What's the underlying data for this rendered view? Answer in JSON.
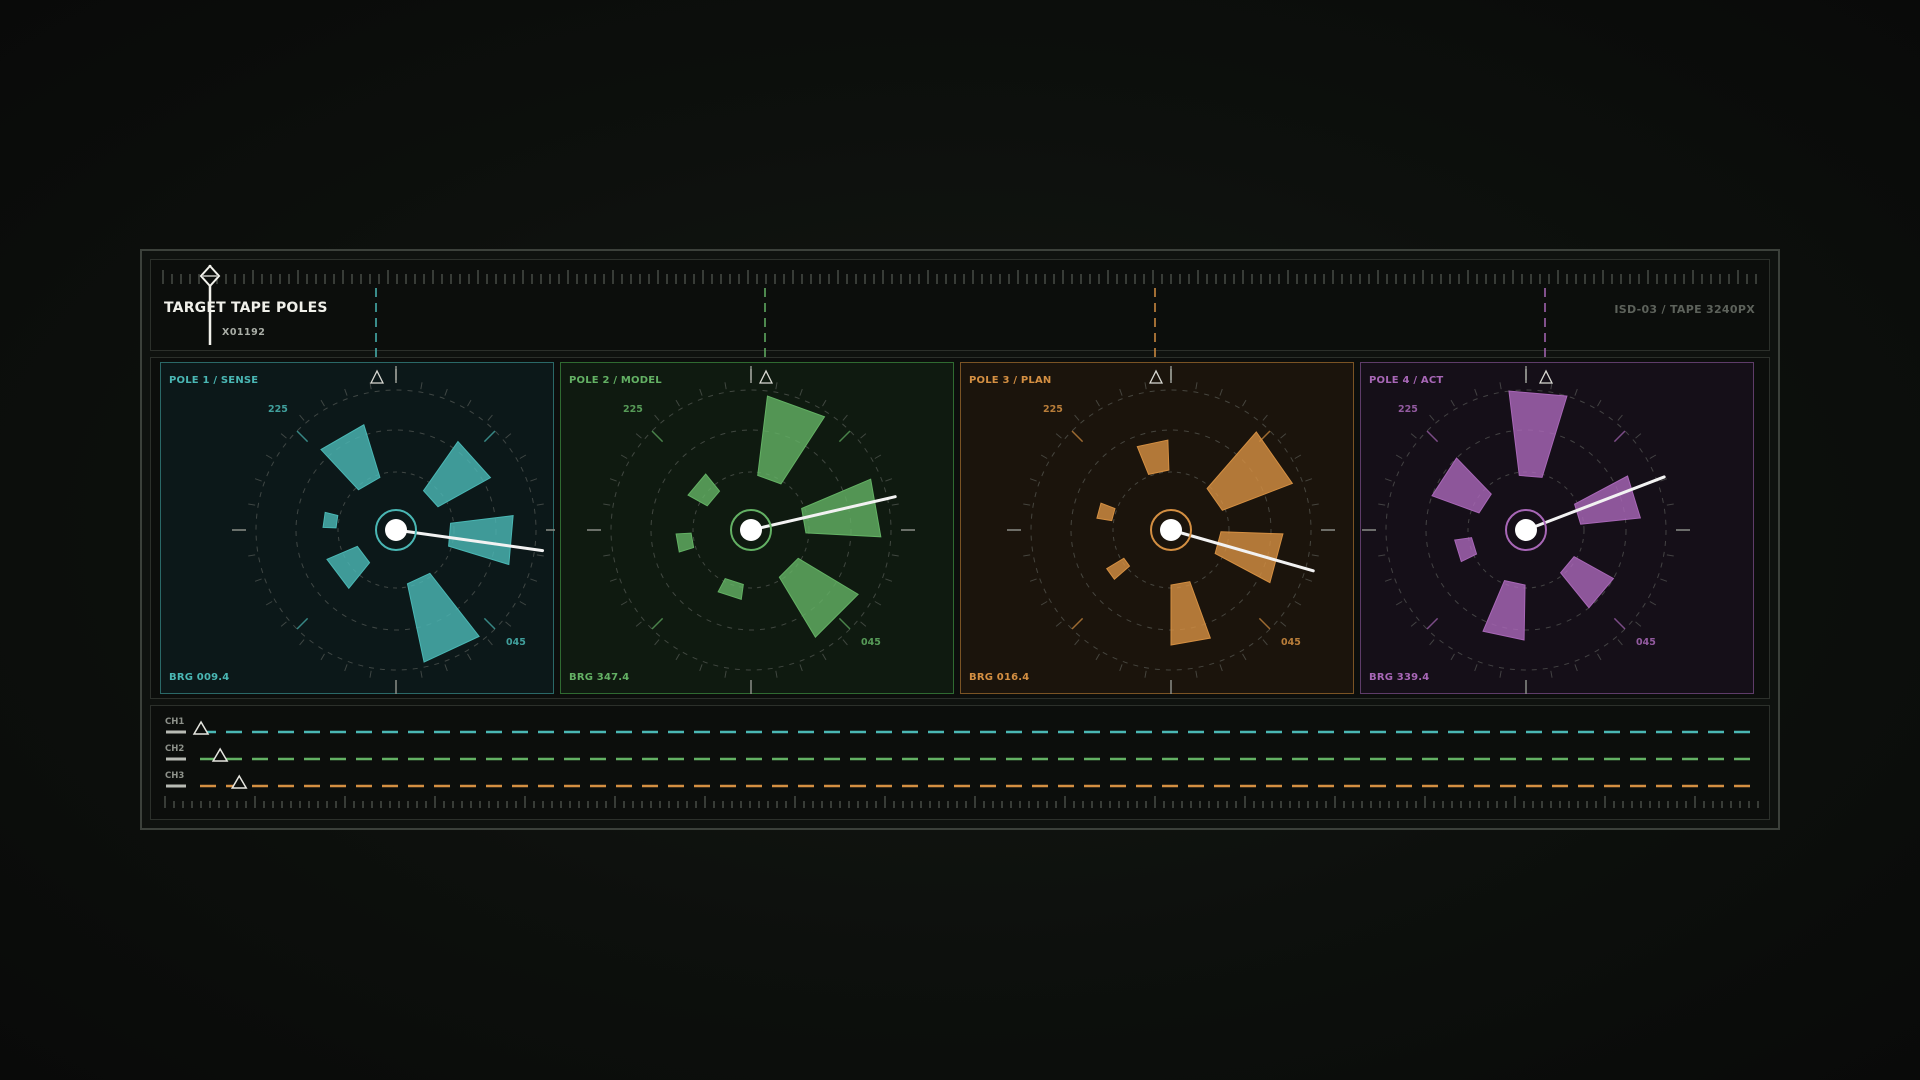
{
  "header": {
    "title": "TARGET TAPE POLES",
    "subtitle": "X01192",
    "tape_id": "ISD-03 / TAPE 3240PX"
  },
  "colors": {
    "sense": "#4ab7b4",
    "model": "#63b164",
    "plan": "#d48f42",
    "act": "#a867b7",
    "needle": "#f2f2f2",
    "frame": "#3c413b"
  },
  "icons": {
    "playhead": "diamond-marker-icon",
    "pole_marker": "triangle-marker-icon",
    "channel_marker": "triangle-marker-icon"
  },
  "poles": [
    {
      "title": "POLE 1 / SENSE",
      "bearing": "BRG 009.4",
      "label_225": "225",
      "label_045": "045",
      "color_key": "sense",
      "bg": "#0c1819",
      "border": "#2a6867",
      "needle_deg": 8,
      "wedges": [
        {
          "bearing": 240,
          "width": 26,
          "r0": 55,
          "r1": 110
        },
        {
          "bearing": 318,
          "width": 26,
          "r0": 48,
          "r1": 108
        },
        {
          "bearing": 5,
          "width": 24,
          "r0": 55,
          "r1": 118
        },
        {
          "bearing": 65,
          "width": 26,
          "r0": 55,
          "r1": 135
        },
        {
          "bearing": 143,
          "width": 28,
          "r0": 42,
          "r1": 75
        },
        {
          "bearing": 188,
          "width": 12,
          "r0": 60,
          "r1": 73
        }
      ]
    },
    {
      "title": "POLE 2 / MODEL",
      "bearing": "BRG 347.4",
      "label_225": "225",
      "label_045": "045",
      "color_key": "model",
      "bg": "#0f1a10",
      "border": "#2f6a31",
      "needle_deg": 347,
      "wedges": [
        {
          "bearing": 290,
          "width": 26,
          "r0": 55,
          "r1": 135
        },
        {
          "bearing": 350,
          "width": 26,
          "r0": 55,
          "r1": 130
        },
        {
          "bearing": 45,
          "width": 28,
          "r0": 55,
          "r1": 125
        },
        {
          "bearing": 108,
          "width": 20,
          "r0": 55,
          "r1": 70
        },
        {
          "bearing": 170,
          "width": 14,
          "r0": 60,
          "r1": 75
        },
        {
          "bearing": 220,
          "width": 22,
          "r0": 50,
          "r1": 72
        }
      ]
    },
    {
      "title": "POLE 3 / PLAN",
      "bearing": "BRG 016.4",
      "label_225": "225",
      "label_045": "045",
      "color_key": "plan",
      "bg": "#1b140c",
      "border": "#7a5324",
      "needle_deg": 16,
      "wedges": [
        {
          "bearing": 258,
          "width": 20,
          "r0": 60,
          "r1": 90
        },
        {
          "bearing": 325,
          "width": 28,
          "r0": 55,
          "r1": 130
        },
        {
          "bearing": 15,
          "width": 26,
          "r0": 50,
          "r1": 112
        },
        {
          "bearing": 80,
          "width": 20,
          "r0": 55,
          "r1": 115
        },
        {
          "bearing": 144,
          "width": 10,
          "r0": 55,
          "r1": 75
        },
        {
          "bearing": 195,
          "width": 12,
          "r0": 60,
          "r1": 75
        }
      ]
    },
    {
      "title": "POLE 4 / ACT",
      "bearing": "BRG 339.4",
      "label_225": "225",
      "label_045": "045",
      "color_key": "act",
      "bg": "#150f18",
      "border": "#5e3c69",
      "needle_deg": 339,
      "wedges": [
        {
          "bearing": 275,
          "width": 24,
          "r0": 55,
          "r1": 140
        },
        {
          "bearing": 343,
          "width": 22,
          "r0": 55,
          "r1": 115
        },
        {
          "bearing": 40,
          "width": 22,
          "r0": 55,
          "r1": 100
        },
        {
          "bearing": 102,
          "width": 22,
          "r0": 55,
          "r1": 110
        },
        {
          "bearing": 163,
          "width": 18,
          "r0": 55,
          "r1": 72
        },
        {
          "bearing": 213,
          "width": 26,
          "r0": 50,
          "r1": 100
        }
      ]
    }
  ],
  "channels": [
    {
      "label": "CH1",
      "color_key": "sense",
      "marker_pos": 0.022
    },
    {
      "label": "CH2",
      "color_key": "model",
      "marker_pos": 0.034
    },
    {
      "label": "CH3",
      "color_key": "plan",
      "marker_pos": 0.046
    }
  ]
}
